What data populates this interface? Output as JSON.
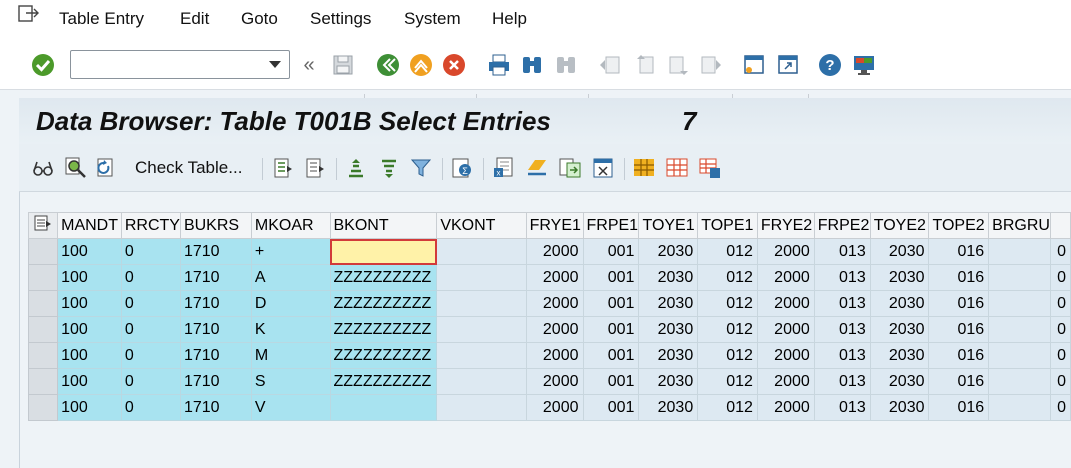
{
  "menu": {
    "items": [
      "Table Entry",
      "Edit",
      "Goto",
      "Settings",
      "System",
      "Help"
    ]
  },
  "toolbar": {
    "command_value": "",
    "icons": [
      "enter-icon",
      "back-icon",
      "save-icon",
      "exit-icon",
      "cancel-icon",
      "print-icon",
      "find-icon",
      "find-next-icon",
      "first-page-icon",
      "previous-page-icon",
      "next-page-icon",
      "last-page-icon",
      "create-session-icon",
      "shortcut-icon",
      "help-icon",
      "customize-layout-icon"
    ]
  },
  "title": {
    "text": "Data Browser: Table T001B Select Entries",
    "count": "7"
  },
  "app_toolbar": {
    "check_table_label": "Check Table..."
  },
  "table": {
    "columns": [
      "MANDT",
      "RRCTY",
      "BUKRS",
      "MKOAR",
      "BKONT",
      "VKONT",
      "FRYE1",
      "FRPE1",
      "TOYE1",
      "TOPE1",
      "FRYE2",
      "FRPE2",
      "TOYE2",
      "TOPE2",
      "BRGRU",
      ""
    ],
    "rows": [
      [
        "100",
        "0",
        "1710",
        "+",
        "",
        "",
        "2000",
        "001",
        "2030",
        "012",
        "2000",
        "013",
        "2030",
        "016",
        "",
        "0"
      ],
      [
        "100",
        "0",
        "1710",
        "A",
        "ZZZZZZZZZZ",
        "",
        "2000",
        "001",
        "2030",
        "012",
        "2000",
        "013",
        "2030",
        "016",
        "",
        "0"
      ],
      [
        "100",
        "0",
        "1710",
        "D",
        "ZZZZZZZZZZ",
        "",
        "2000",
        "001",
        "2030",
        "012",
        "2000",
        "013",
        "2030",
        "016",
        "",
        "0"
      ],
      [
        "100",
        "0",
        "1710",
        "K",
        "ZZZZZZZZZZ",
        "",
        "2000",
        "001",
        "2030",
        "012",
        "2000",
        "013",
        "2030",
        "016",
        "",
        "0"
      ],
      [
        "100",
        "0",
        "1710",
        "M",
        "ZZZZZZZZZZ",
        "",
        "2000",
        "001",
        "2030",
        "012",
        "2000",
        "013",
        "2030",
        "016",
        "",
        "0"
      ],
      [
        "100",
        "0",
        "1710",
        "S",
        "ZZZZZZZZZZ",
        "",
        "2000",
        "001",
        "2030",
        "012",
        "2000",
        "013",
        "2030",
        "016",
        "",
        "0"
      ],
      [
        "100",
        "0",
        "1710",
        "V",
        "",
        "",
        "2000",
        "001",
        "2030",
        "012",
        "2000",
        "013",
        "2030",
        "016",
        "",
        "0"
      ]
    ]
  },
  "colors": {
    "key_cell": "#a8e3f0",
    "value_cell": "#dde9f2",
    "current_cell": "#fff2a8",
    "current_border": "#d23a3a"
  }
}
